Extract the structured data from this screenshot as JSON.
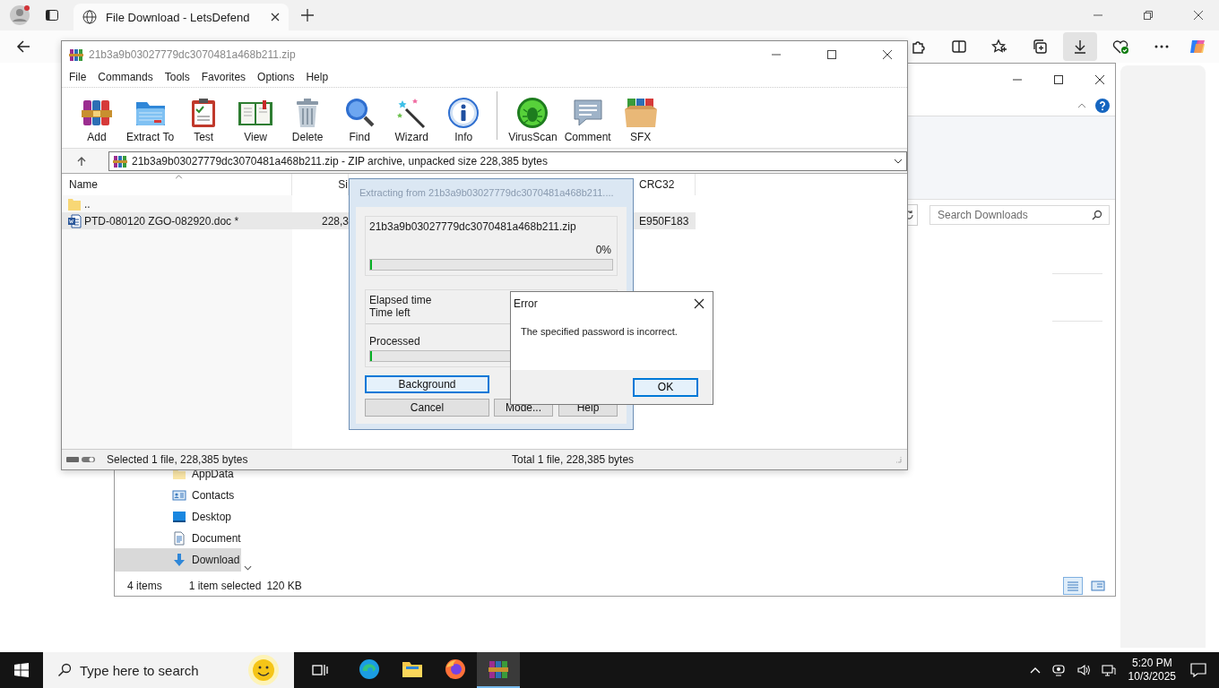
{
  "browser": {
    "tabs": [
      {
        "title": "File Download - LetsDefend",
        "selected": true
      }
    ]
  },
  "explorer": {
    "search": {
      "placeholder": "Search Downloads"
    },
    "nav_items": [
      {
        "label": "AppData",
        "selected": false
      },
      {
        "label": "Contacts",
        "selected": false
      },
      {
        "label": "Desktop",
        "selected": false
      },
      {
        "label": "Document",
        "selected": false
      },
      {
        "label": "Download",
        "selected": true
      }
    ],
    "status": {
      "items": "4 items",
      "selection": "1 item selected",
      "size": "120 KB"
    }
  },
  "winrar": {
    "title": "21b3a9b03027779dc3070481a468b211.zip",
    "menu": [
      "File",
      "Commands",
      "Tools",
      "Favorites",
      "Options",
      "Help"
    ],
    "toolbar": [
      [
        "Add",
        "Extract To",
        "Test",
        "View",
        "Delete",
        "Find",
        "Wizard",
        "Info"
      ],
      [
        "VirusScan",
        "Comment",
        "SFX"
      ]
    ],
    "path": "21b3a9b03027779dc3070481a468b211.zip - ZIP archive, unpacked size 228,385 bytes",
    "columns": {
      "name": "Name",
      "size": "Si",
      "crc": "CRC32"
    },
    "rows": [
      {
        "kind": "folder",
        "name": "..",
        "selected": false
      },
      {
        "kind": "document",
        "name": "PTD-080120 ZGO-082920.doc *",
        "size": "228,3",
        "crc": "E950F183",
        "selected": true
      }
    ],
    "status_left": "Selected 1 file, 228,385 bytes",
    "status_right": "Total 1 file, 228,385 bytes"
  },
  "extract_dialog": {
    "title": "Extracting from 21b3a9b03027779dc3070481a468b211....",
    "file": "21b3a9b03027779dc3070481a468b211.zip",
    "progress": {
      "percent": "0%",
      "level": 0
    },
    "elapsed_label": "Elapsed time",
    "time_left_label": "Time left",
    "processed": {
      "label": "Processed",
      "level": 0
    },
    "buttons": [
      {
        "label": "Background",
        "default": true
      },
      {
        "label": "Cancel",
        "default": false
      },
      {
        "label": "Mode...",
        "default": false
      },
      {
        "label": "Help",
        "default": false
      }
    ]
  },
  "error_dialog": {
    "title": "Error",
    "message": "The specified password is incorrect.",
    "button": "OK"
  },
  "taskbar": {
    "search_placeholder": "Type here to search",
    "apps": [
      {
        "selected": false
      },
      {
        "selected": false
      },
      {
        "selected": false
      },
      {
        "selected": true
      }
    ],
    "time": "5:20 PM",
    "date": "10/3/2025"
  }
}
